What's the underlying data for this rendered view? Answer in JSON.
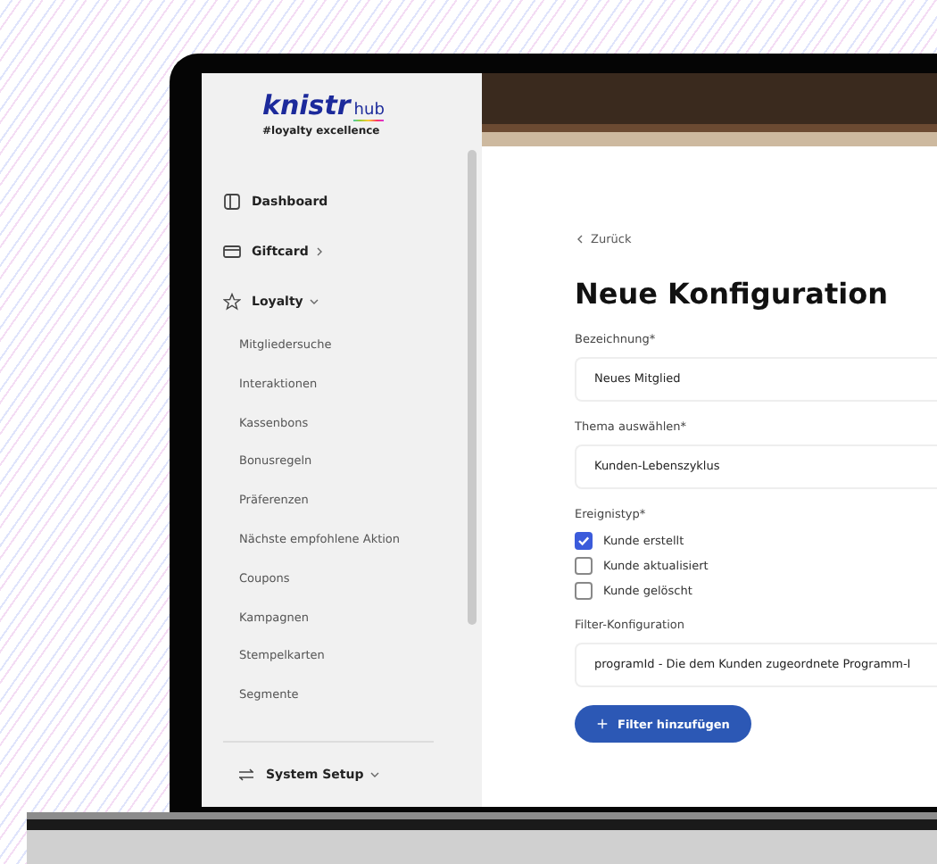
{
  "sidebar": {
    "logo": {
      "wordmark": "knistr",
      "suffix": "hub",
      "tagline": "#loyalty excellence"
    },
    "items": [
      {
        "label": "Dashboard"
      },
      {
        "label": "Giftcard",
        "expanded": false
      },
      {
        "label": "Loyalty",
        "expanded": true,
        "children": [
          "Mitgliedersuche",
          "Interaktionen",
          "Kassenbons",
          "Bonusregeln",
          "Präferenzen",
          "Nächste empfohlene Aktion",
          "Coupons",
          "Kampagnen",
          "Stempelkarten",
          "Segmente"
        ]
      }
    ],
    "footer_item": {
      "label": "System Setup",
      "expanded": true
    }
  },
  "main": {
    "back_link": "Zurück",
    "title": "Neue Konfiguration",
    "fields": [
      {
        "kind": "text",
        "label": "Bezeichnung*",
        "value": "Neues Mitglied"
      },
      {
        "kind": "text",
        "label": "Thema auswählen*",
        "value": "Kunden-Lebenszyklus"
      },
      {
        "kind": "checkboxes",
        "label": "Ereignistyp*",
        "options": [
          {
            "label": "Kunde erstellt",
            "checked": true
          },
          {
            "label": "Kunde aktualisiert",
            "checked": false
          },
          {
            "label": "Kunde gelöscht",
            "checked": false
          }
        ]
      },
      {
        "kind": "text",
        "label": "Filter-Konfiguration",
        "value": "programId - Die dem Kunden zugeordnete Programm-I"
      }
    ],
    "add_button": "Filter hinzufügen"
  }
}
